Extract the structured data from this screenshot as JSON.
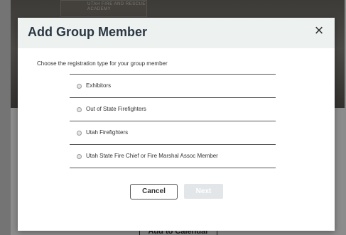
{
  "background": {
    "banner_text": "UTAH FIRE AND RESCUE\nACADEMY",
    "calendar_label": "Add to Calendar"
  },
  "modal": {
    "title": "Add Group Member",
    "close_glyph": "×",
    "prompt": "Choose the registration type for your group member",
    "options": [
      {
        "label": "Exhibitors"
      },
      {
        "label": "Out of State Firefighters"
      },
      {
        "label": "Utah Firefighters"
      },
      {
        "label": "Utah State Fire Chief or Fire Marshal Assoc Member"
      }
    ],
    "cancel_label": "Cancel",
    "next_label": "Next"
  }
}
